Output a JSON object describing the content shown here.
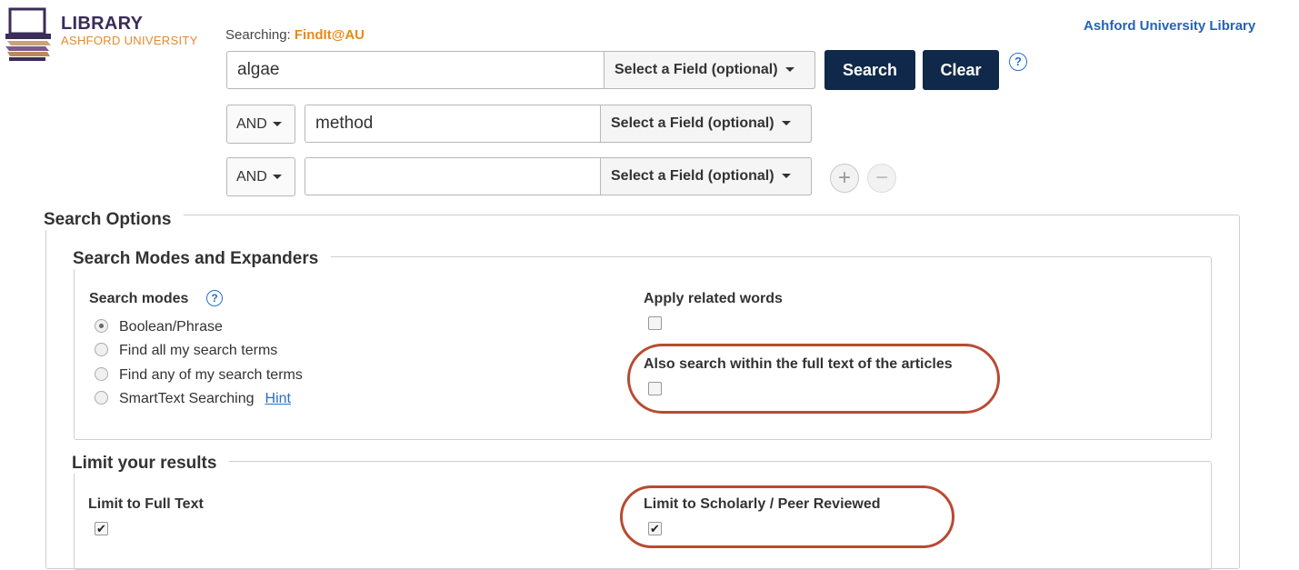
{
  "brand": {
    "title": "LIBRARY",
    "subtitle": "ASHFORD UNIVERSITY",
    "icon": "library-laptop-books-icon"
  },
  "header": {
    "searching_prefix": "Searching: ",
    "database": "FindIt@AU",
    "top_link": "Ashford University Library"
  },
  "search": {
    "rows": [
      {
        "value": "algae",
        "field": "Select a Field (optional)"
      },
      {
        "operator": "AND",
        "value": "method",
        "field": "Select a Field (optional)"
      },
      {
        "operator": "AND",
        "value": "",
        "field": "Select a Field (optional)"
      }
    ],
    "search_button": "Search",
    "clear_button": "Clear",
    "help_glyph": "?",
    "add_glyph": "+",
    "remove_glyph": "−"
  },
  "options": {
    "title": "Search Options",
    "modes_section": {
      "title": "Search Modes and Expanders",
      "modes_label": "Search modes",
      "modes": [
        {
          "label": "Boolean/Phrase",
          "selected": true
        },
        {
          "label": "Find all my search terms",
          "selected": false
        },
        {
          "label": "Find any of my search terms",
          "selected": false
        },
        {
          "label": "SmartText Searching",
          "selected": false
        }
      ],
      "hint_link": "Hint",
      "apply_related": {
        "label": "Apply related words",
        "checked": false
      },
      "full_text_search": {
        "label": "Also search within the full text of the articles",
        "checked": false
      }
    },
    "limit_section": {
      "title": "Limit your results",
      "full_text": {
        "label": "Limit to Full Text",
        "checked": true
      },
      "scholarly": {
        "label": "Limit to Scholarly / Peer Reviewed",
        "checked": true
      }
    }
  },
  "colors": {
    "brand_purple": "#3b2c5a",
    "brand_orange": "#e48a2d",
    "button_navy": "#10294a",
    "link_blue": "#2563b3",
    "annotation_red": "#b94a32"
  }
}
